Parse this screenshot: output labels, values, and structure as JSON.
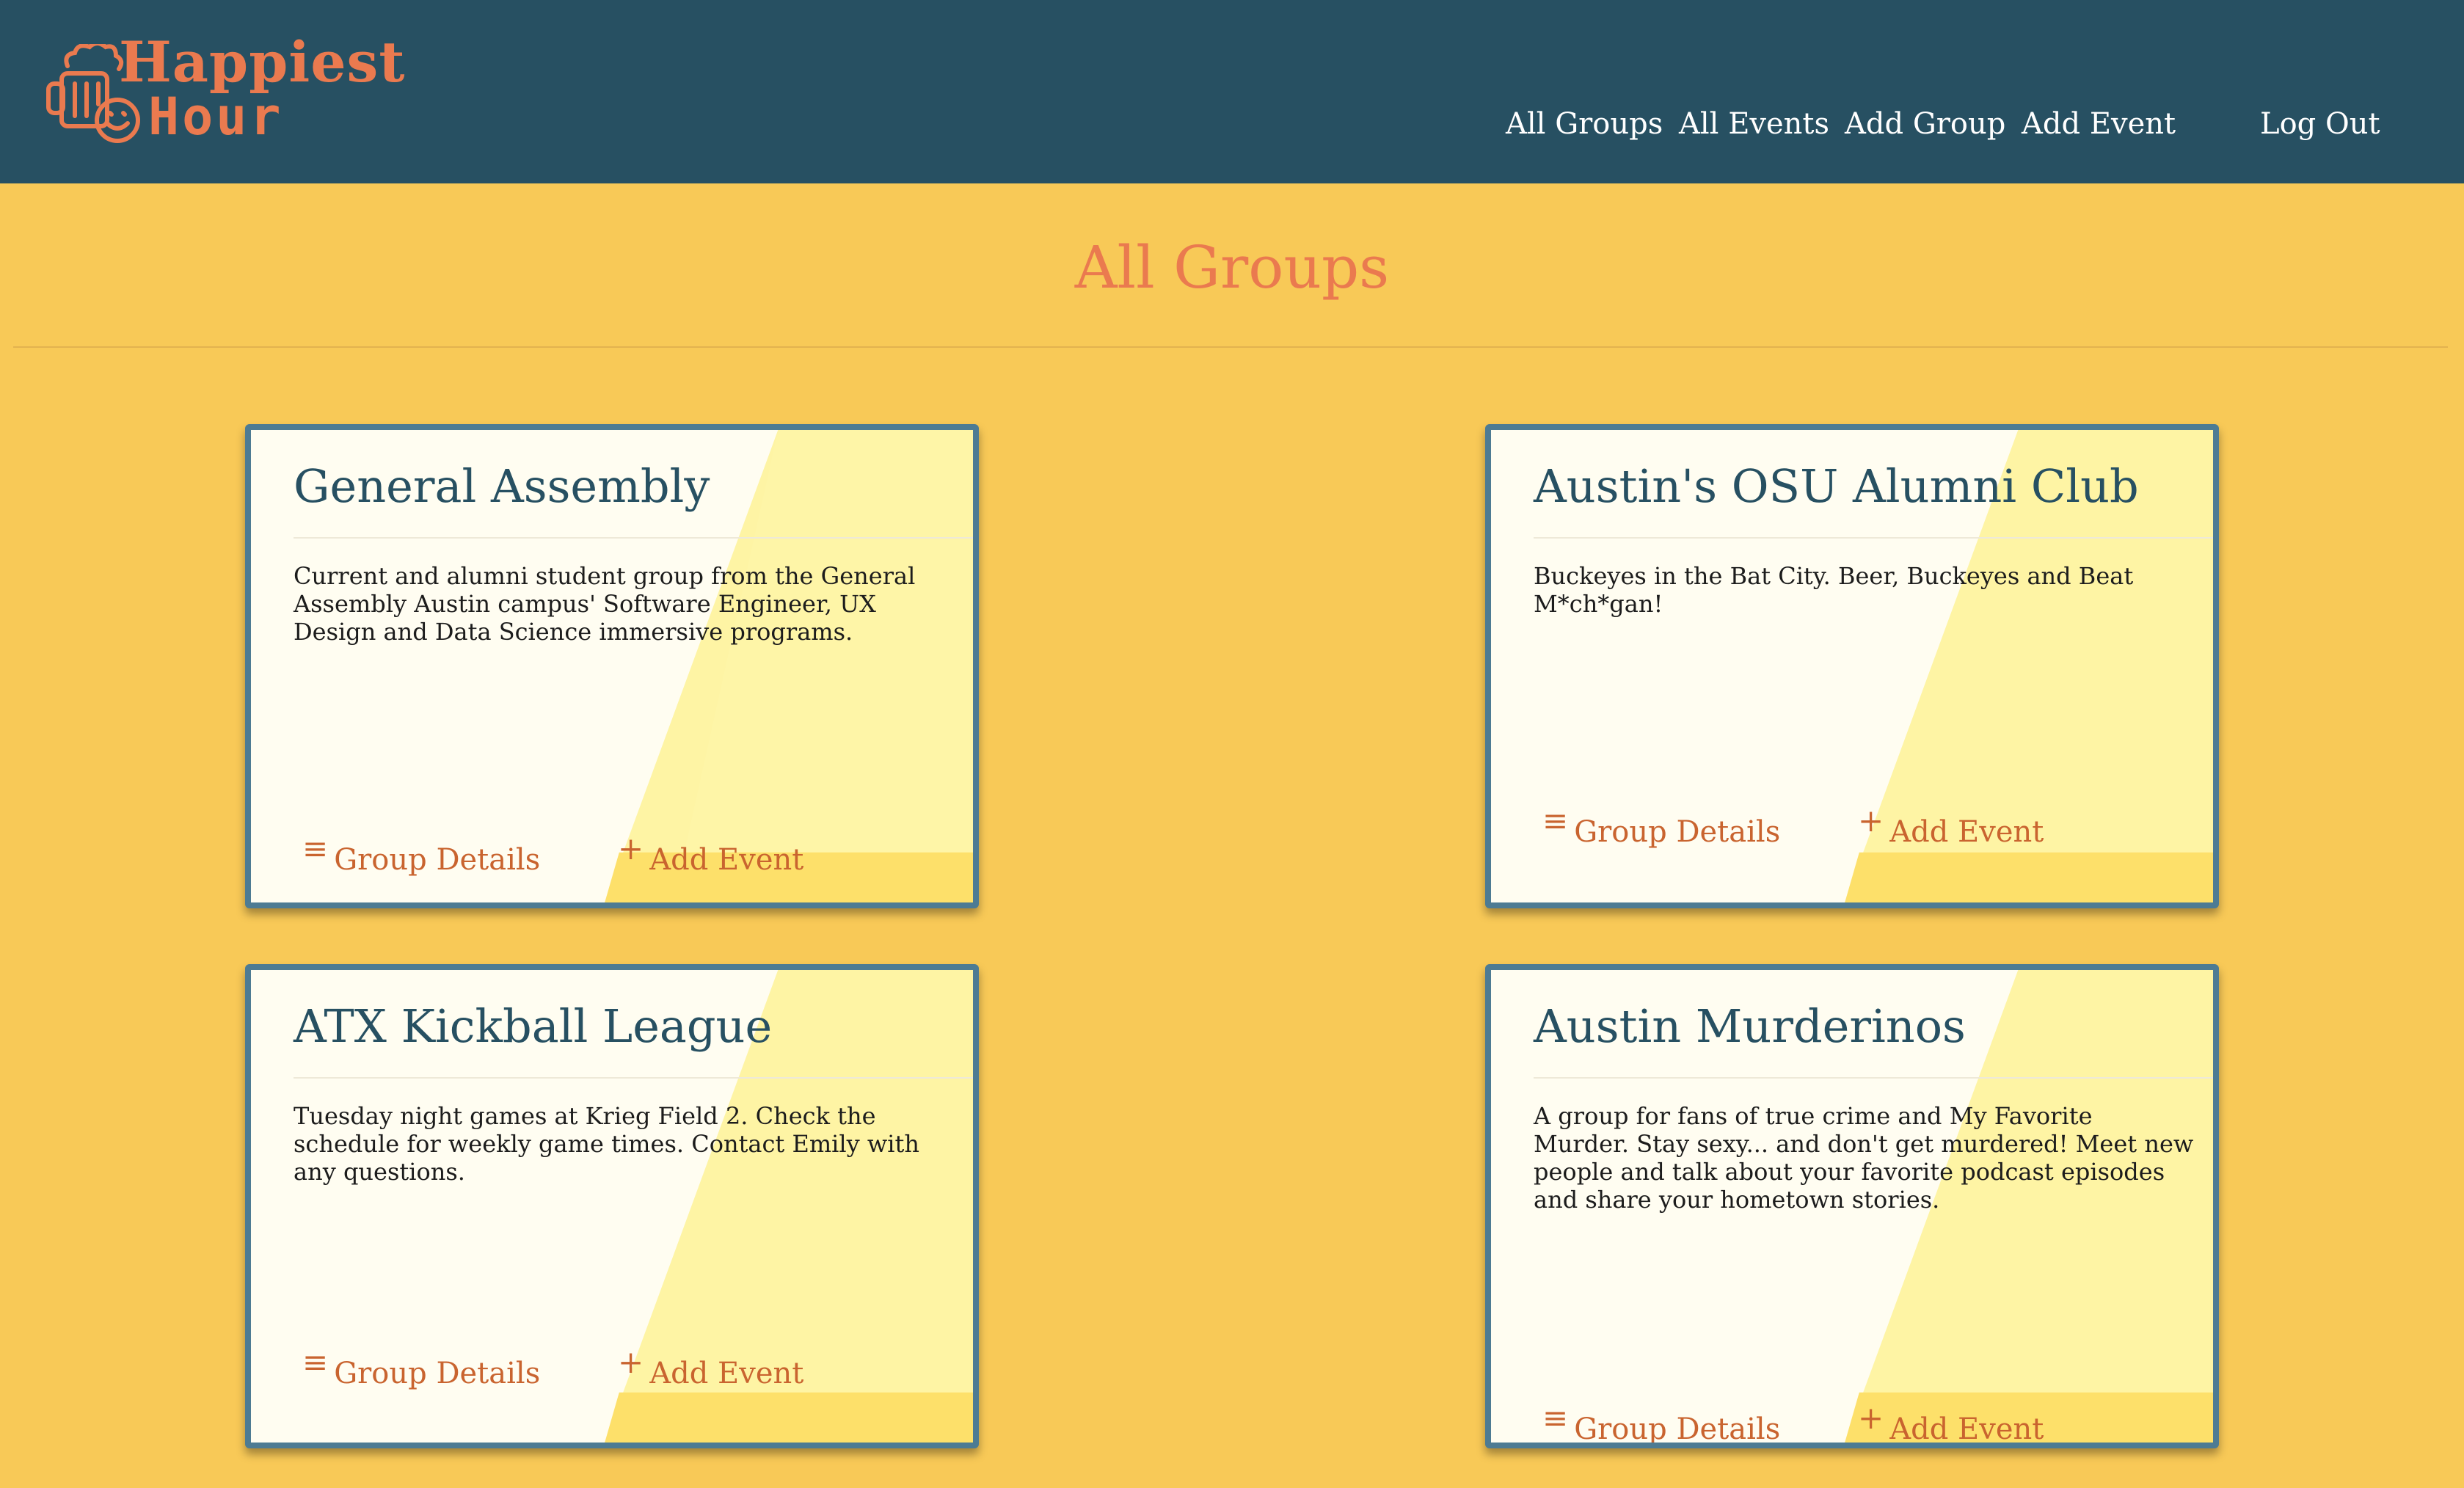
{
  "brand": {
    "line1": "Happiest",
    "line2": "Hour",
    "color": "#ea7a4f"
  },
  "nav": {
    "links": [
      "All Groups",
      "All Events",
      "Add Group",
      "Add Event",
      "Log Out"
    ]
  },
  "page": {
    "title": "All Groups"
  },
  "groups": [
    {
      "name": "General Assembly",
      "description": "Current and alumni student group from the General Assembly Austin campus' Software Engineer, UX Design and Data Science immersive programs.",
      "details_label": "Group Details",
      "add_event_label": "Add Event"
    },
    {
      "name": "Austin's OSU Alumni Club",
      "description": "Buckeyes in the Bat City. Beer, Buckeyes and Beat M*ch*gan!",
      "details_label": "Group Details",
      "add_event_label": "Add Event"
    },
    {
      "name": "ATX Kickball League",
      "description": "Tuesday night games at Krieg Field 2. Check the schedule for weekly game times. Contact Emily with any questions.",
      "details_label": "Group Details",
      "add_event_label": "Add Event"
    },
    {
      "name": "Austin Murderinos",
      "description": "A group for fans of true crime and My Favorite Murder. Stay sexy... and don't get murdered! Meet new people and talk about your favorite podcast episodes and share your hometown stories.",
      "details_label": "Group Details",
      "add_event_label": "Add Event"
    }
  ],
  "icons": {
    "details": "menu-lines-icon",
    "add": "plus-icon",
    "logo": "beer-mug-smiley-icon"
  },
  "colors": {
    "nav_bg": "#275062",
    "page_bg": "#f8c957",
    "card_border": "#4d7b93",
    "accent": "#ea7a4f",
    "link": "#c9642f"
  }
}
